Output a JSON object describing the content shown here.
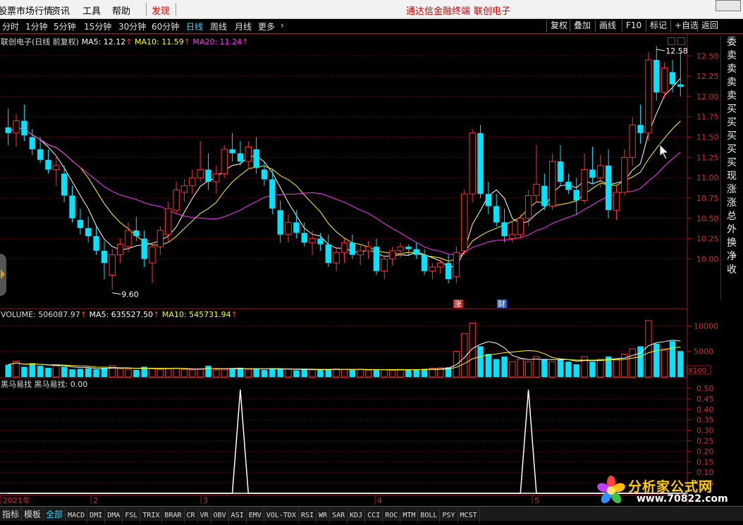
{
  "menubar": {
    "items": [
      "股票市场行情",
      "资讯",
      "工具",
      "帮助"
    ],
    "find": "发现",
    "center_app": "通达信金融终端",
    "center_stock": "联创电子"
  },
  "timeframes": {
    "items": [
      "分时",
      "1分钟",
      "5分钟",
      "15分钟",
      "30分钟",
      "60分钟",
      "日线",
      "周线",
      "月线",
      "更多"
    ],
    "active": "日线",
    "more_arrow": "›"
  },
  "right_buttons": [
    "复权",
    "叠加",
    "画线",
    "F10",
    "标记",
    "+自选",
    "返回"
  ],
  "main_info": {
    "name": "联创电子(日线 前复权)",
    "ma5": "MA5: 12.12",
    "ma10": "MA10: 11.59",
    "ma20": "MA20: 11.24"
  },
  "price_axis": [
    "12.50",
    "12.25",
    "12.00",
    "11.75",
    "11.50",
    "11.25",
    "11.00",
    "10.75",
    "10.50",
    "10.25",
    "10.00"
  ],
  "annotations": {
    "high": "12.58",
    "low": "9.60",
    "zhang": "涨",
    "cai": "财"
  },
  "volume_info": {
    "label": "VOLUME: 506087.97",
    "ma5": "MA5: 635527.50",
    "ma10": "MA10: 545731.94"
  },
  "volume_axis": [
    "10000",
    "5000"
  ],
  "volume_unit": "X100",
  "indicator_info": {
    "label": "黑马易找  黑马易找: 0.00"
  },
  "indicator_axis": [
    "0.50",
    "0.45",
    "0.40",
    "0.35",
    "0.30",
    "0.25",
    "0.20",
    "0.15",
    "0.10",
    "0.05"
  ],
  "date_axis": [
    "2021年",
    "2",
    "3",
    "4",
    "5"
  ],
  "sidebar": [
    "委",
    "卖",
    "卖",
    "卖",
    "卖",
    "买",
    "买",
    "买",
    "买",
    "买",
    "现",
    "涨",
    "涨",
    "总",
    "外",
    "换",
    "净",
    "收"
  ],
  "tabs": [
    "指标",
    "模板",
    "全部",
    "MACD",
    "DMI",
    "DMA",
    "FSL",
    "TRIX",
    "BRAR",
    "CR",
    "VR",
    "OBV",
    "ASI",
    "EMV",
    "VOL-TDX",
    "RSI",
    "WR",
    "SAR",
    "KDJ",
    "CCI",
    "ROC",
    "MTM",
    "BOLL",
    "PSY",
    "MCST"
  ],
  "tabs_active": "全部",
  "watermark": {
    "text": "分析家公式网",
    "url": "www.70822.com"
  },
  "colors": {
    "up": "#ff3232",
    "down": "#00e5ff",
    "ma5": "#ffffff",
    "ma10": "#ffff00",
    "ma20": "#ff33ff",
    "accent": "#2fd7ff"
  },
  "chart_data": {
    "type": "candlestick",
    "title": "联创电子(日线 前复权)",
    "ylim": [
      9.5,
      12.65
    ],
    "high": 12.58,
    "low": 9.6,
    "ma_latest": {
      "MA5": 12.12,
      "MA10": 11.59,
      "MA20": 11.24
    },
    "volume_latest": {
      "VOLUME": 506087.97,
      "MA5": 635527.5,
      "MA10": 545731.94
    },
    "volume_ylim": [
      0,
      11000
    ],
    "indicator": {
      "name": "黑马易找",
      "value": 0.0,
      "ylim": [
        0,
        0.52
      ],
      "spikes": [
        0.53,
        0.53
      ]
    },
    "ohlc": [
      [
        11.62,
        11.85,
        11.4,
        11.55
      ],
      [
        11.55,
        11.78,
        11.38,
        11.7
      ],
      [
        11.7,
        11.9,
        11.45,
        11.52
      ],
      [
        11.5,
        11.6,
        11.28,
        11.35
      ],
      [
        11.35,
        11.5,
        11.18,
        11.22
      ],
      [
        11.22,
        11.35,
        11.05,
        11.1
      ],
      [
        11.1,
        11.28,
        10.9,
        11.15
      ],
      [
        11.05,
        11.15,
        10.7,
        10.78
      ],
      [
        10.78,
        10.9,
        10.45,
        10.5
      ],
      [
        10.48,
        10.62,
        10.3,
        10.38
      ],
      [
        10.38,
        10.52,
        10.2,
        10.28
      ],
      [
        10.28,
        10.4,
        10.05,
        10.1
      ],
      [
        10.1,
        10.22,
        9.75,
        9.95
      ],
      [
        9.8,
        10.12,
        9.62,
        10.05
      ],
      [
        10.05,
        10.25,
        9.95,
        10.18
      ],
      [
        10.15,
        10.45,
        10.08,
        10.35
      ],
      [
        10.35,
        10.52,
        10.22,
        10.28
      ],
      [
        10.25,
        10.35,
        9.9,
        10.0
      ],
      [
        9.95,
        10.2,
        9.7,
        10.15
      ],
      [
        10.15,
        10.4,
        10.05,
        10.35
      ],
      [
        10.3,
        10.7,
        10.2,
        10.62
      ],
      [
        10.6,
        10.95,
        10.55,
        10.85
      ],
      [
        10.82,
        10.98,
        10.7,
        10.9
      ],
      [
        10.9,
        11.1,
        10.8,
        11.0
      ],
      [
        11.0,
        11.45,
        10.95,
        11.1
      ],
      [
        11.1,
        11.3,
        10.85,
        10.95
      ],
      [
        10.95,
        11.15,
        10.8,
        11.05
      ],
      [
        11.05,
        11.4,
        11.0,
        11.35
      ],
      [
        11.35,
        11.55,
        11.2,
        11.3
      ],
      [
        11.3,
        11.45,
        11.15,
        11.2
      ],
      [
        11.2,
        11.45,
        11.1,
        11.38
      ],
      [
        11.35,
        11.5,
        11.05,
        11.12
      ],
      [
        11.1,
        11.2,
        10.9,
        10.98
      ],
      [
        10.98,
        11.1,
        10.55,
        10.62
      ],
      [
        10.6,
        10.72,
        10.2,
        10.3
      ],
      [
        10.3,
        10.55,
        10.2,
        10.45
      ],
      [
        10.45,
        10.6,
        10.25,
        10.32
      ],
      [
        10.32,
        10.45,
        10.15,
        10.2
      ],
      [
        10.2,
        10.35,
        10.05,
        10.25
      ],
      [
        10.25,
        10.32,
        10.1,
        10.18
      ],
      [
        10.18,
        10.3,
        9.9,
        9.95
      ],
      [
        9.95,
        10.15,
        9.85,
        10.08
      ],
      [
        10.08,
        10.25,
        9.95,
        10.2
      ],
      [
        10.2,
        10.3,
        10.0,
        10.05
      ],
      [
        10.05,
        10.18,
        9.92,
        10.1
      ],
      [
        10.1,
        10.22,
        10.0,
        10.15
      ],
      [
        10.15,
        10.25,
        9.8,
        9.85
      ],
      [
        9.85,
        10.05,
        9.75,
        10.0
      ],
      [
        10.0,
        10.15,
        9.92,
        10.1
      ],
      [
        10.1,
        10.2,
        10.02,
        10.15
      ],
      [
        10.15,
        10.18,
        10.05,
        10.12
      ],
      [
        10.12,
        10.2,
        10.0,
        10.05
      ],
      [
        10.05,
        10.12,
        9.8,
        9.85
      ],
      [
        9.85,
        9.95,
        9.75,
        9.9
      ],
      [
        9.9,
        10.0,
        9.82,
        9.95
      ],
      [
        9.95,
        10.05,
        9.7,
        9.75
      ],
      [
        9.78,
        10.15,
        9.7,
        10.08
      ],
      [
        10.1,
        10.85,
        10.05,
        10.8
      ],
      [
        10.8,
        11.6,
        10.7,
        11.55
      ],
      [
        11.55,
        11.65,
        10.75,
        10.8
      ],
      [
        10.8,
        10.95,
        10.55,
        10.65
      ],
      [
        10.65,
        10.8,
        10.4,
        10.45
      ],
      [
        10.45,
        10.62,
        10.2,
        10.28
      ],
      [
        10.25,
        10.45,
        10.2,
        10.3
      ],
      [
        10.3,
        10.55,
        10.25,
        10.5
      ],
      [
        10.5,
        10.85,
        10.4,
        10.78
      ],
      [
        10.78,
        11.4,
        10.7,
        10.92
      ],
      [
        10.9,
        11.05,
        10.6,
        10.65
      ],
      [
        10.65,
        11.3,
        10.6,
        11.2
      ],
      [
        11.2,
        11.4,
        10.9,
        10.95
      ],
      [
        10.95,
        11.05,
        10.8,
        10.85
      ],
      [
        10.85,
        11.0,
        10.55,
        10.72
      ],
      [
        10.72,
        11.3,
        10.68,
        11.1
      ],
      [
        11.1,
        11.38,
        10.92,
        11.0
      ],
      [
        11.0,
        11.28,
        10.88,
        11.15
      ],
      [
        11.15,
        11.35,
        10.5,
        10.6
      ],
      [
        10.6,
        10.9,
        10.48,
        10.82
      ],
      [
        10.82,
        11.35,
        10.78,
        11.25
      ],
      [
        11.25,
        11.75,
        11.15,
        11.65
      ],
      [
        11.65,
        11.9,
        11.42,
        11.55
      ],
      [
        11.55,
        12.55,
        11.45,
        12.45
      ],
      [
        12.45,
        12.62,
        11.95,
        12.05
      ],
      [
        12.05,
        12.42,
        11.98,
        12.35
      ],
      [
        12.3,
        12.45,
        12.05,
        12.15
      ],
      [
        12.15,
        12.55,
        12.0,
        12.12
      ]
    ],
    "volume": [
      2400,
      3100,
      2000,
      2700,
      2200,
      1800,
      2400,
      2000,
      1500,
      1600,
      1700,
      1500,
      1800,
      2200,
      1600,
      1500,
      1400,
      2000,
      1700,
      1500,
      1600,
      1700,
      1500,
      1400,
      1500,
      2200,
      1400,
      1500,
      1700,
      1800,
      1500,
      1600,
      1400,
      1700,
      1500,
      1600,
      1300,
      1500,
      1400,
      1400,
      1500,
      1600,
      1500,
      1400,
      1500,
      1300,
      1500,
      1400,
      1300,
      1500,
      1400,
      1500,
      1600,
      1700,
      1800,
      1900,
      5000,
      8500,
      10500,
      6000,
      4500,
      3500,
      4000,
      3000,
      3500,
      3000,
      4000,
      3500,
      3000,
      3500,
      3000,
      2500,
      4000,
      3000,
      3500,
      4000,
      3500,
      4500,
      5500,
      6000,
      11000,
      6500,
      5500,
      7000,
      5060
    ]
  }
}
